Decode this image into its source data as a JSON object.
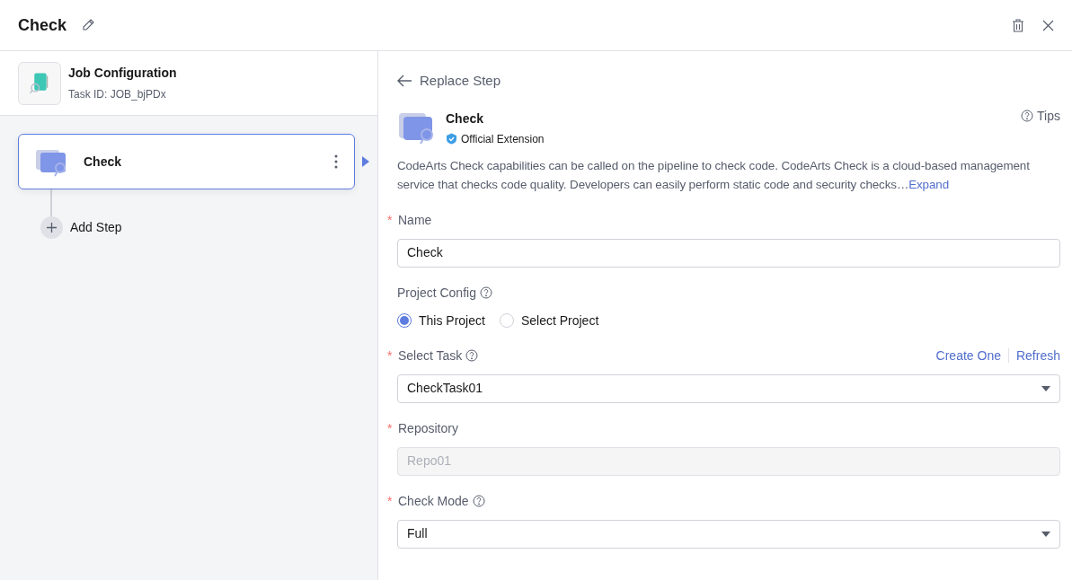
{
  "header": {
    "title": "Check"
  },
  "job": {
    "title": "Job Configuration",
    "task_id": "Task ID: JOB_bjPDx"
  },
  "steps": [
    {
      "label": "Check",
      "selected": true
    }
  ],
  "add_step": "Add Step",
  "detail": {
    "back": "Replace Step",
    "plugin_name": "Check",
    "badge": "Official Extension",
    "tips": "Tips",
    "description": "CodeArts Check capabilities can be called on the pipeline to check code. CodeArts Check is a cloud-based management service that checks code quality. Developers can easily perform static code and security checks…",
    "expand": "Expand"
  },
  "fields": [
    {
      "kind": "text",
      "required_mark": "*",
      "label": "Name",
      "help": false,
      "value": "Check",
      "disabled": false
    },
    {
      "kind": "radio",
      "label": "Project Config",
      "help": true,
      "options": [
        {
          "label": "This Project",
          "selected": true
        },
        {
          "label": "Select Project",
          "selected": false
        }
      ]
    },
    {
      "kind": "select",
      "required_mark": "*",
      "label": "Select Task",
      "help": true,
      "value": "CheckTask01",
      "links": [
        "Create One",
        "Refresh"
      ]
    },
    {
      "kind": "text",
      "required_mark": "*",
      "label": "Repository",
      "help": false,
      "value": "Repo01",
      "disabled": true
    },
    {
      "kind": "select",
      "required_mark": "*",
      "label": "Check Mode",
      "help": true,
      "value": "Full"
    }
  ]
}
